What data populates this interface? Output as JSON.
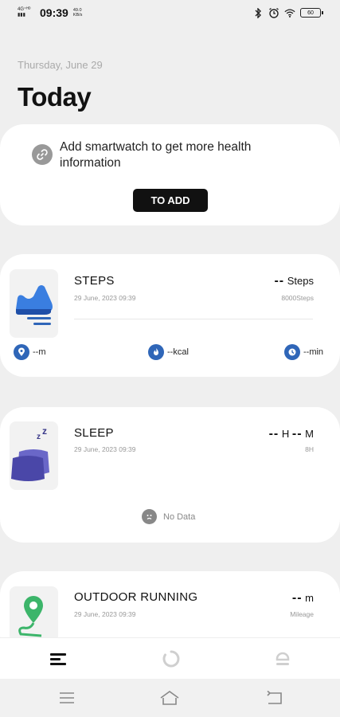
{
  "status_bar": {
    "network": "4G⁺ᴴᴰ\n▮▮▮",
    "time": "09:39",
    "speed": "49.0\nKB/s",
    "battery": "60"
  },
  "header": {
    "date": "Thursday, June 29",
    "title": "Today"
  },
  "device_card": {
    "message": "Add smartwatch to get more health information",
    "button": "TO ADD"
  },
  "steps": {
    "title": "STEPS",
    "date": "29 June, 2023 09:39",
    "value": "--",
    "unit": "Steps",
    "goal": "8000Steps",
    "metrics": {
      "distance": "--m",
      "calories": "--kcal",
      "duration": "--min"
    }
  },
  "sleep": {
    "title": "SLEEP",
    "date": "29 June, 2023 09:39",
    "hours": "--",
    "hours_unit": "H",
    "minutes": "--",
    "minutes_unit": "M",
    "goal": "8H",
    "empty": "No Data"
  },
  "running": {
    "title": "OUTDOOR RUNNING",
    "date": "29 June, 2023 09:39",
    "value": "--",
    "unit": "m",
    "sub": "Mileage"
  },
  "colors": {
    "accent": "#2f66b8",
    "button": "#111111",
    "background": "#efefef"
  }
}
